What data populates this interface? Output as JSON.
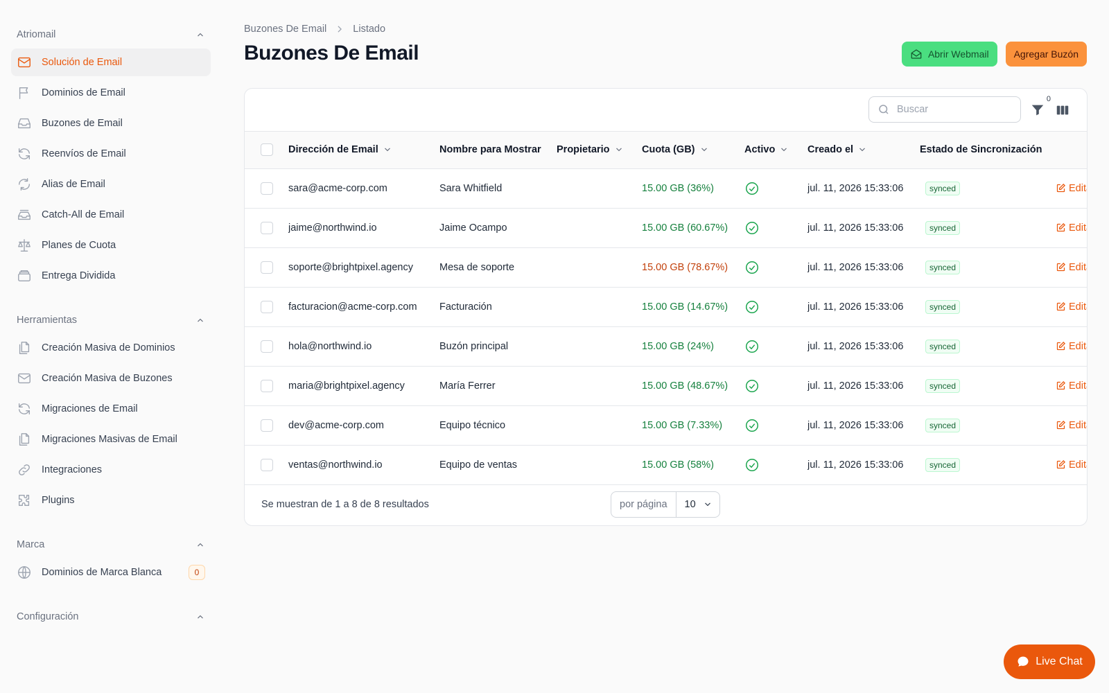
{
  "sidebar": {
    "groups": [
      {
        "title": "Atriomail",
        "items": [
          {
            "label": "Solución de Email",
            "icon": "mail-icon",
            "active": true
          },
          {
            "label": "Dominios de Email",
            "icon": "flag-icon"
          },
          {
            "label": "Buzones de Email",
            "icon": "inbox-icon"
          },
          {
            "label": "Reenvíos de Email",
            "icon": "refresh-icon"
          },
          {
            "label": "Alias de Email",
            "icon": "arrows-cycle-icon"
          },
          {
            "label": "Catch-All de Email",
            "icon": "inbox-stack-icon"
          },
          {
            "label": "Planes de Cuota",
            "icon": "scale-icon"
          },
          {
            "label": "Entrega Dividida",
            "icon": "archive-icon"
          }
        ]
      },
      {
        "title": "Herramientas",
        "items": [
          {
            "label": "Creación Masiva de Dominios",
            "icon": "documents-icon"
          },
          {
            "label": "Creación Masiva de Buzones",
            "icon": "mail-icon"
          },
          {
            "label": "Migraciones de Email",
            "icon": "refresh-icon"
          },
          {
            "label": "Migraciones Masivas de Email",
            "icon": "documents-icon"
          },
          {
            "label": "Integraciones",
            "icon": "link-icon"
          },
          {
            "label": "Plugins",
            "icon": "puzzle-icon"
          }
        ]
      },
      {
        "title": "Marca",
        "items": [
          {
            "label": "Dominios de Marca Blanca",
            "icon": "globe-icon",
            "badge": "0"
          }
        ]
      },
      {
        "title": "Configuración",
        "items": []
      }
    ]
  },
  "breadcrumb": {
    "parent": "Buzones De Email",
    "current": "Listado"
  },
  "page": {
    "title": "Buzones De Email"
  },
  "actions": {
    "webmail": "Abrir Webmail",
    "add": "Agregar Buzón"
  },
  "toolbar": {
    "search_placeholder": "Buscar",
    "filter_count": "0"
  },
  "table": {
    "columns": [
      {
        "label": "Dirección de Email",
        "sortable": true
      },
      {
        "label": "Nombre para Mostrar",
        "sortable": false
      },
      {
        "label": "Propietario",
        "sortable": true
      },
      {
        "label": "Cuota (GB)",
        "sortable": true
      },
      {
        "label": "Activo",
        "sortable": true
      },
      {
        "label": "Creado el",
        "sortable": true
      },
      {
        "label": "Estado de Sincronización",
        "sortable": false
      }
    ],
    "edit_label": "Editar",
    "rows": [
      {
        "email": "sara@acme-corp.com",
        "name": "Sara Whitfield",
        "owner": "",
        "quota": "15.00 GB (36%)",
        "quota_level": "green",
        "created": "jul. 11, 2026 15:33:06",
        "sync": "synced"
      },
      {
        "email": "jaime@northwind.io",
        "name": "Jaime Ocampo",
        "owner": "",
        "quota": "15.00 GB (60.67%)",
        "quota_level": "green",
        "created": "jul. 11, 2026 15:33:06",
        "sync": "synced"
      },
      {
        "email": "soporte@brightpixel.agency",
        "name": "Mesa de soporte",
        "owner": "",
        "quota": "15.00 GB (78.67%)",
        "quota_level": "orange",
        "created": "jul. 11, 2026 15:33:06",
        "sync": "synced"
      },
      {
        "email": "facturacion@acme-corp.com",
        "name": "Facturación",
        "owner": "",
        "quota": "15.00 GB (14.67%)",
        "quota_level": "green",
        "created": "jul. 11, 2026 15:33:06",
        "sync": "synced"
      },
      {
        "email": "hola@northwind.io",
        "name": "Buzón principal",
        "owner": "",
        "quota": "15.00 GB (24%)",
        "quota_level": "green",
        "created": "jul. 11, 2026 15:33:06",
        "sync": "synced"
      },
      {
        "email": "maria@brightpixel.agency",
        "name": "María Ferrer",
        "owner": "",
        "quota": "15.00 GB (48.67%)",
        "quota_level": "green",
        "created": "jul. 11, 2026 15:33:06",
        "sync": "synced"
      },
      {
        "email": "dev@acme-corp.com",
        "name": "Equipo técnico",
        "owner": "",
        "quota": "15.00 GB (7.33%)",
        "quota_level": "green",
        "created": "jul. 11, 2026 15:33:06",
        "sync": "synced"
      },
      {
        "email": "ventas@northwind.io",
        "name": "Equipo de ventas",
        "owner": "",
        "quota": "15.00 GB (58%)",
        "quota_level": "green",
        "created": "jul. 11, 2026 15:33:06",
        "sync": "synced"
      }
    ]
  },
  "footer": {
    "summary": "Se muestran de 1 a 8 de 8 resultados",
    "per_page_label": "por página",
    "per_page_value": "10"
  },
  "chat": {
    "label": "Live Chat"
  },
  "colors": {
    "accent": "#ea580c",
    "green_button": "#4ade80",
    "orange_button": "#fb923c"
  }
}
